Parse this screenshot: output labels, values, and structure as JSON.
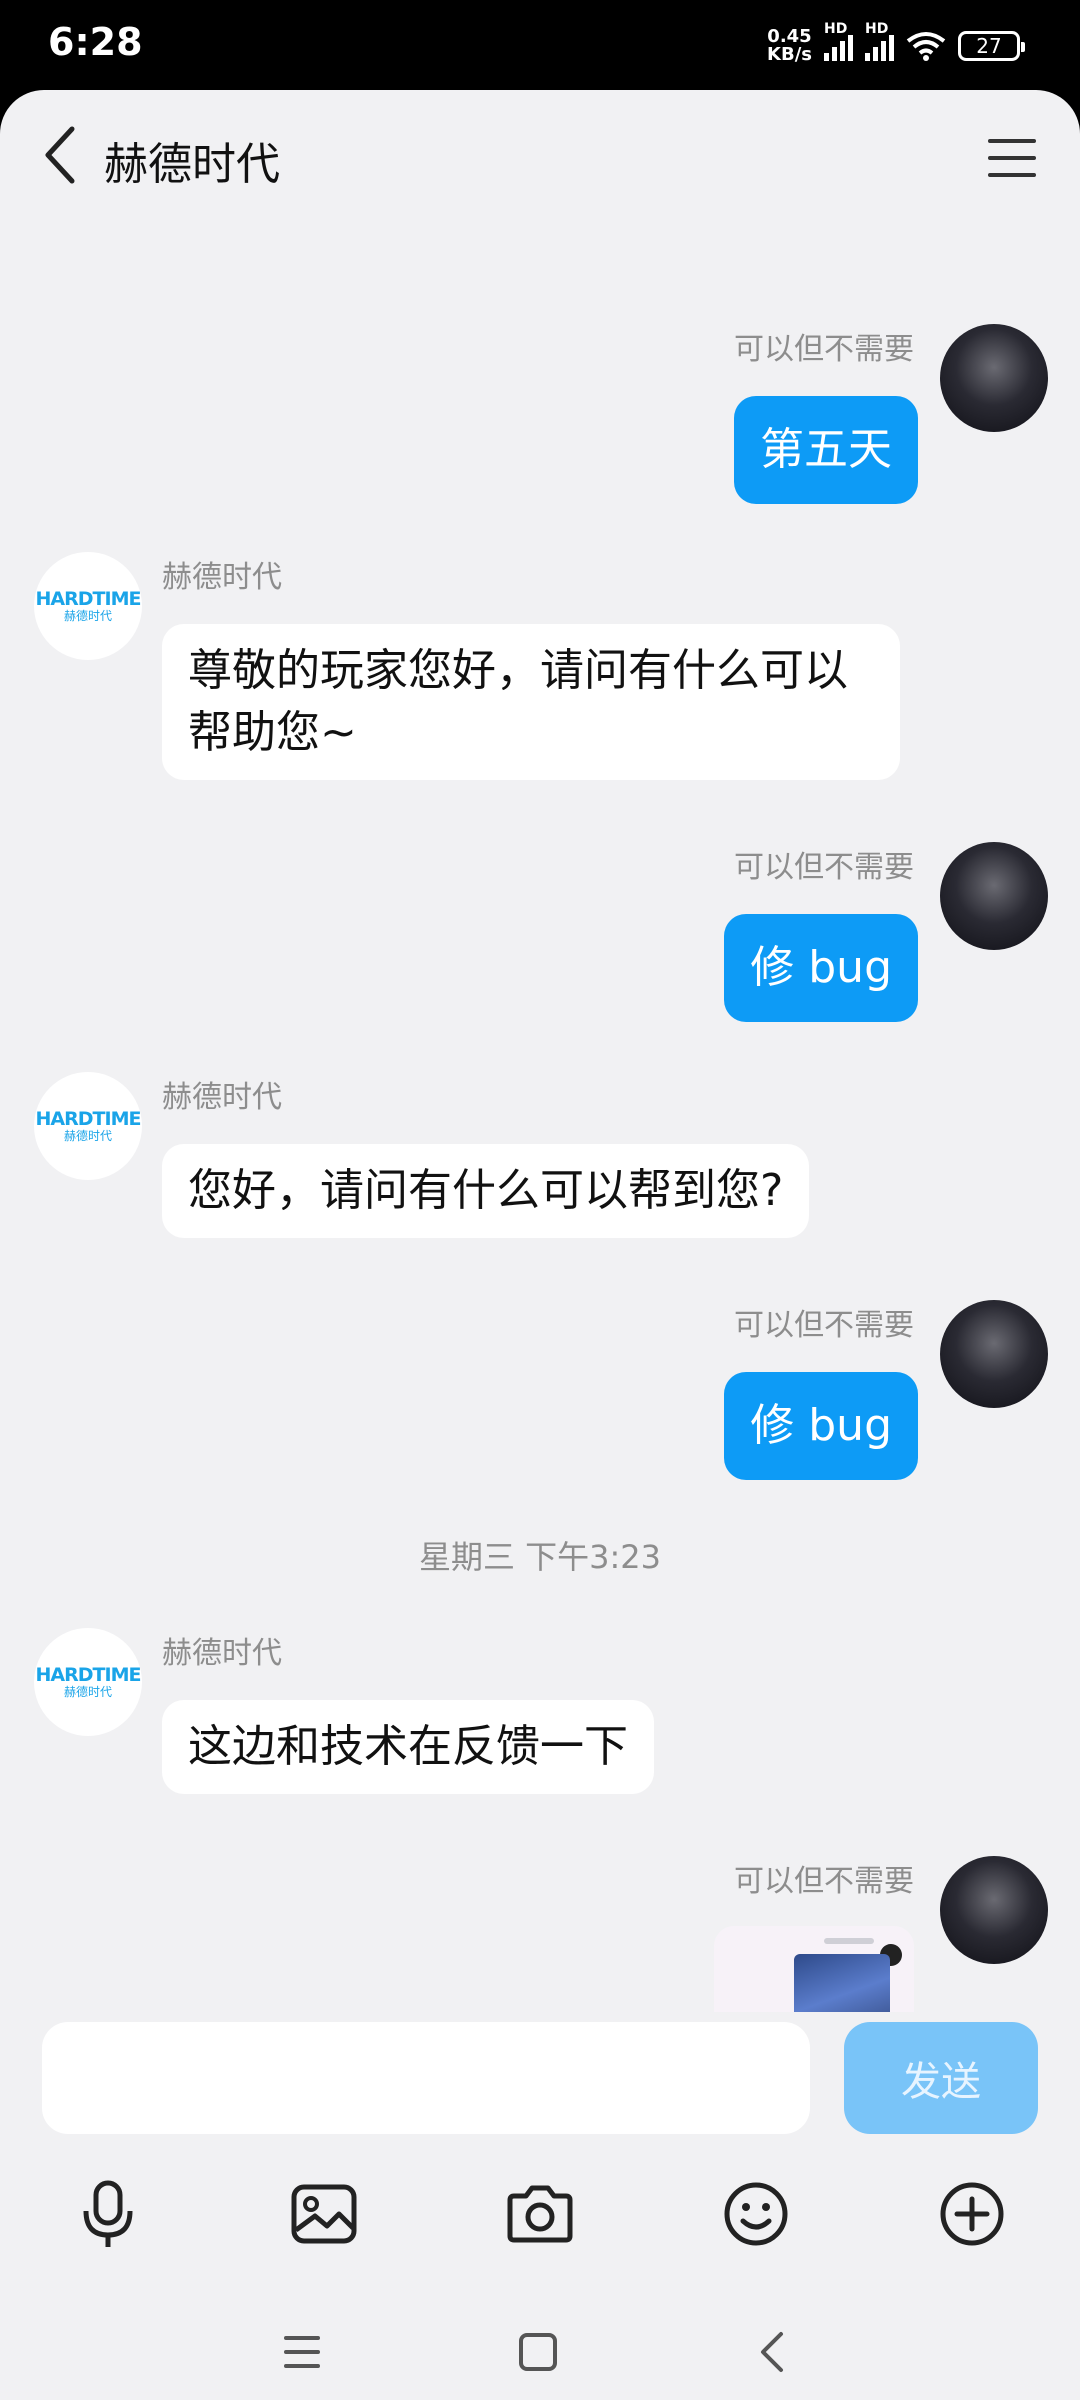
{
  "status": {
    "time": "6:28",
    "net_speed_value": "0.45",
    "net_speed_unit": "KB/s",
    "sim1_label": "HD",
    "sim2_label": "HD",
    "battery": "27"
  },
  "header": {
    "title": "赫德时代",
    "back_icon": "back-arrow-icon",
    "menu_icon": "menu-icon"
  },
  "messages": [
    {
      "side": "right",
      "sender": "可以但不需要",
      "text": "第五天"
    },
    {
      "side": "left",
      "sender": "赫德时代",
      "text": "尊敬的玩家您好，请问有什么可以帮助您~"
    },
    {
      "side": "right",
      "sender": "可以但不需要",
      "text": "修 bug"
    },
    {
      "side": "left",
      "sender": "赫德时代",
      "text": "您好，请问有什么可以帮到您?"
    },
    {
      "side": "right",
      "sender": "可以但不需要",
      "text": "修 bug"
    },
    {
      "side": "left",
      "sender": "赫德时代",
      "text": "这边和技术在反馈一下"
    },
    {
      "side": "right",
      "sender": "可以但不需要",
      "type": "image"
    }
  ],
  "time_separator": "星期三 下午3:23",
  "brand": {
    "logo_text": "HARDTIME",
    "logo_sub": "赫德时代",
    "accent_color": "#0d9bf6"
  },
  "input": {
    "placeholder": "",
    "send_label": "发送"
  },
  "toolbar": [
    "microphone-icon",
    "image-icon",
    "camera-icon",
    "emoji-icon",
    "plus-icon"
  ],
  "nav": [
    "recents-icon",
    "home-icon",
    "back-icon"
  ]
}
